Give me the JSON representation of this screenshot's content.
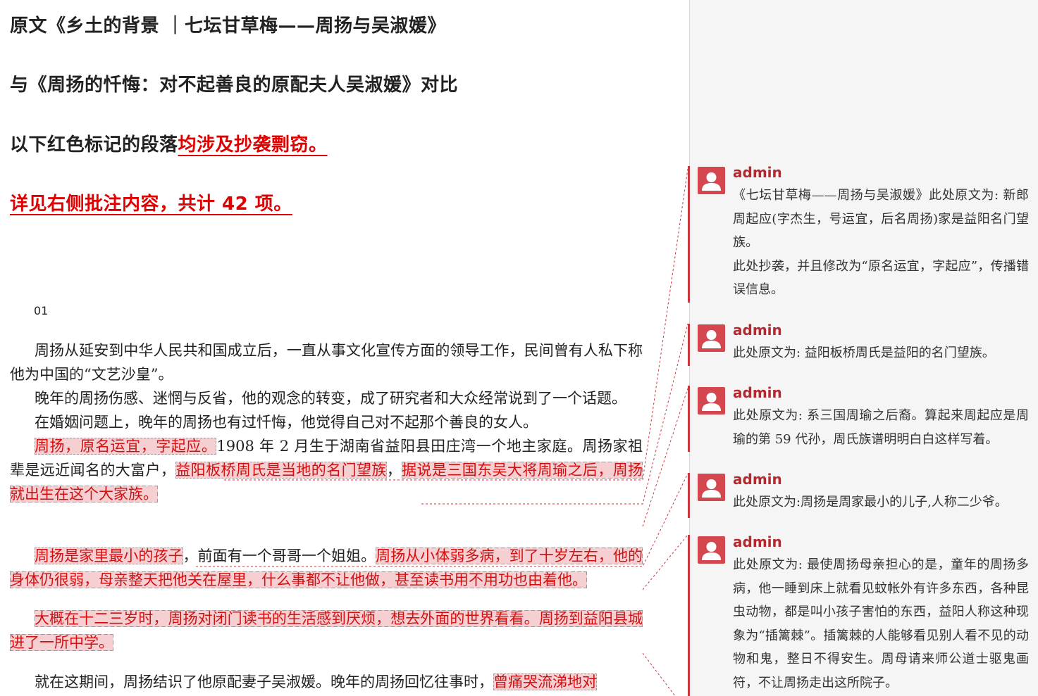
{
  "header": {
    "line1": "原文《乡土的背景 ｜七坛甘草梅——周扬与吴淑媛》",
    "line2": "与《周扬的忏悔：对不起善良的原配夫人吴淑媛》对比",
    "line3_prefix": "以下红色标记的段落",
    "line3_red": "均涉及抄袭剽窃。",
    "line4_red": "详见右侧批注内容，共计 42 项。"
  },
  "section_number": "01",
  "paragraphs": {
    "p1": "周扬从延安到中华人民共和国成立后，一直从事文化宣传方面的领导工作，民间曾有人私下称他为中国的“文艺沙皇”。",
    "p2": "晚年的周扬伤感、迷惘与反省，他的观念的转变，成了研究者和大众经常说到了一个话题。",
    "p3": "在婚姻问题上，晚年的周扬也有过忏悔，他觉得自己对不起那个善良的女人。",
    "p4_hl1": "周扬，原名运宜，字起应。",
    "p4_text1": "1908 年 2 月生于湖南省益阳县田庄湾一个地主家庭。周扬家祖辈是远近闻名的大富户，",
    "p4_hl2": "益阳板桥周氏是当地的名门望族",
    "p4_text2": "，",
    "p4_hl3": "据说是三国东吴大将周瑜之后，周扬就出生在这个大家族。",
    "p5_hl1": "周扬是家里最小的孩子",
    "p5_text1": "，前面有一个哥哥一个姐姐。",
    "p5_hl2": "周扬从小体弱多病，到了十岁左右，他的身体仍很弱，母亲整天把他关在屋里，什么事都不让他做，甚至读书用不用功也由着他。",
    "p6_hl1": "大概在十二三岁时，周扬对闭门读书的生活感到厌烦，想去外面的世界看看。周扬到益阳县城进了一所中学。",
    "p7_text1": "就在这期间，周扬结识了他原配妻子吴淑媛。晚年的周扬回忆往事时，",
    "p7_hl1": "曾痛哭流涕地对"
  },
  "comments": [
    {
      "author": "admin",
      "lines": [
        "《七坛甘草梅——周扬与吴淑媛》此处原文为: 新郎周起应(字杰生，号运宜，后名周扬)家是益阳名门望族。",
        "此处抄袭，并且修改为“原名运宜，字起应”，传播错误信息。"
      ]
    },
    {
      "author": "admin",
      "lines": [
        "此处原文为: 益阳板桥周氏是益阳的名门望族。"
      ]
    },
    {
      "author": "admin",
      "lines": [
        "此处原文为: 系三国周瑜之后裔。算起来周起应是周瑜的第 59 代孙，周氏族谱明明白白这样写着。"
      ]
    },
    {
      "author": "admin",
      "lines": [
        "此处原文为:周扬是周家最小的儿子,人称二少爷。"
      ]
    },
    {
      "author": "admin",
      "lines": [
        "此处原文为: 最使周扬母亲担心的是，童年的周扬多病，他一睡到床上就看见蚊帐外有许多东西，各种昆虫动物，都是叫小孩子害怕的东西，益阳人称这种现象为“插篱棘”。插篱棘的人能够看见别人看不见的动物和鬼，整日不得安生。周母请来师公道士驱鬼画符，不让周扬走出这所院子。"
      ]
    }
  ],
  "colors": {
    "highlight_bg": "#f6cfd3",
    "highlight_text": "#d21010",
    "accent_red": "#e00000",
    "comment_author": "#b7282e",
    "avatar": "#d5474e",
    "margin_bg": "#f5f5f5"
  },
  "icons": {
    "avatar": "user-avatar-icon"
  }
}
